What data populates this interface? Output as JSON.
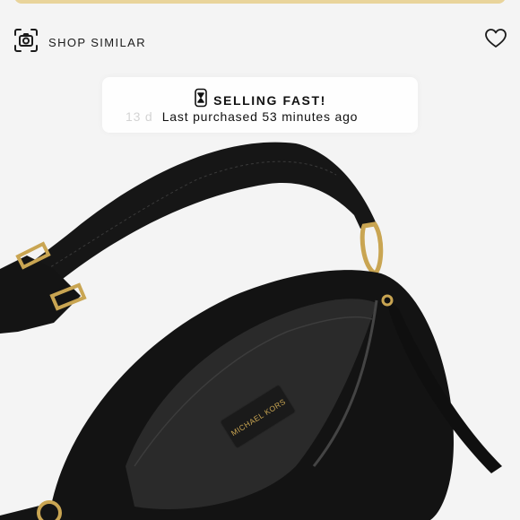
{
  "toolbar": {
    "shop_similar_label": "SHOP SIMILAR",
    "camera_icon": "camera-scan-icon",
    "like_icon": "heart-outline-icon"
  },
  "badge": {
    "icon": "hourglass-icon",
    "title": "SELLING FAST!",
    "subtitle": "Last purchased 53 minutes ago",
    "ghost_text": "13 d"
  },
  "product": {
    "brand_tag": "MICHAEL KORS"
  },
  "colors": {
    "banner": "#e9d49b",
    "background": "#f4f4f4",
    "leather": "#141414",
    "hardware_gold": "#c9a552"
  }
}
